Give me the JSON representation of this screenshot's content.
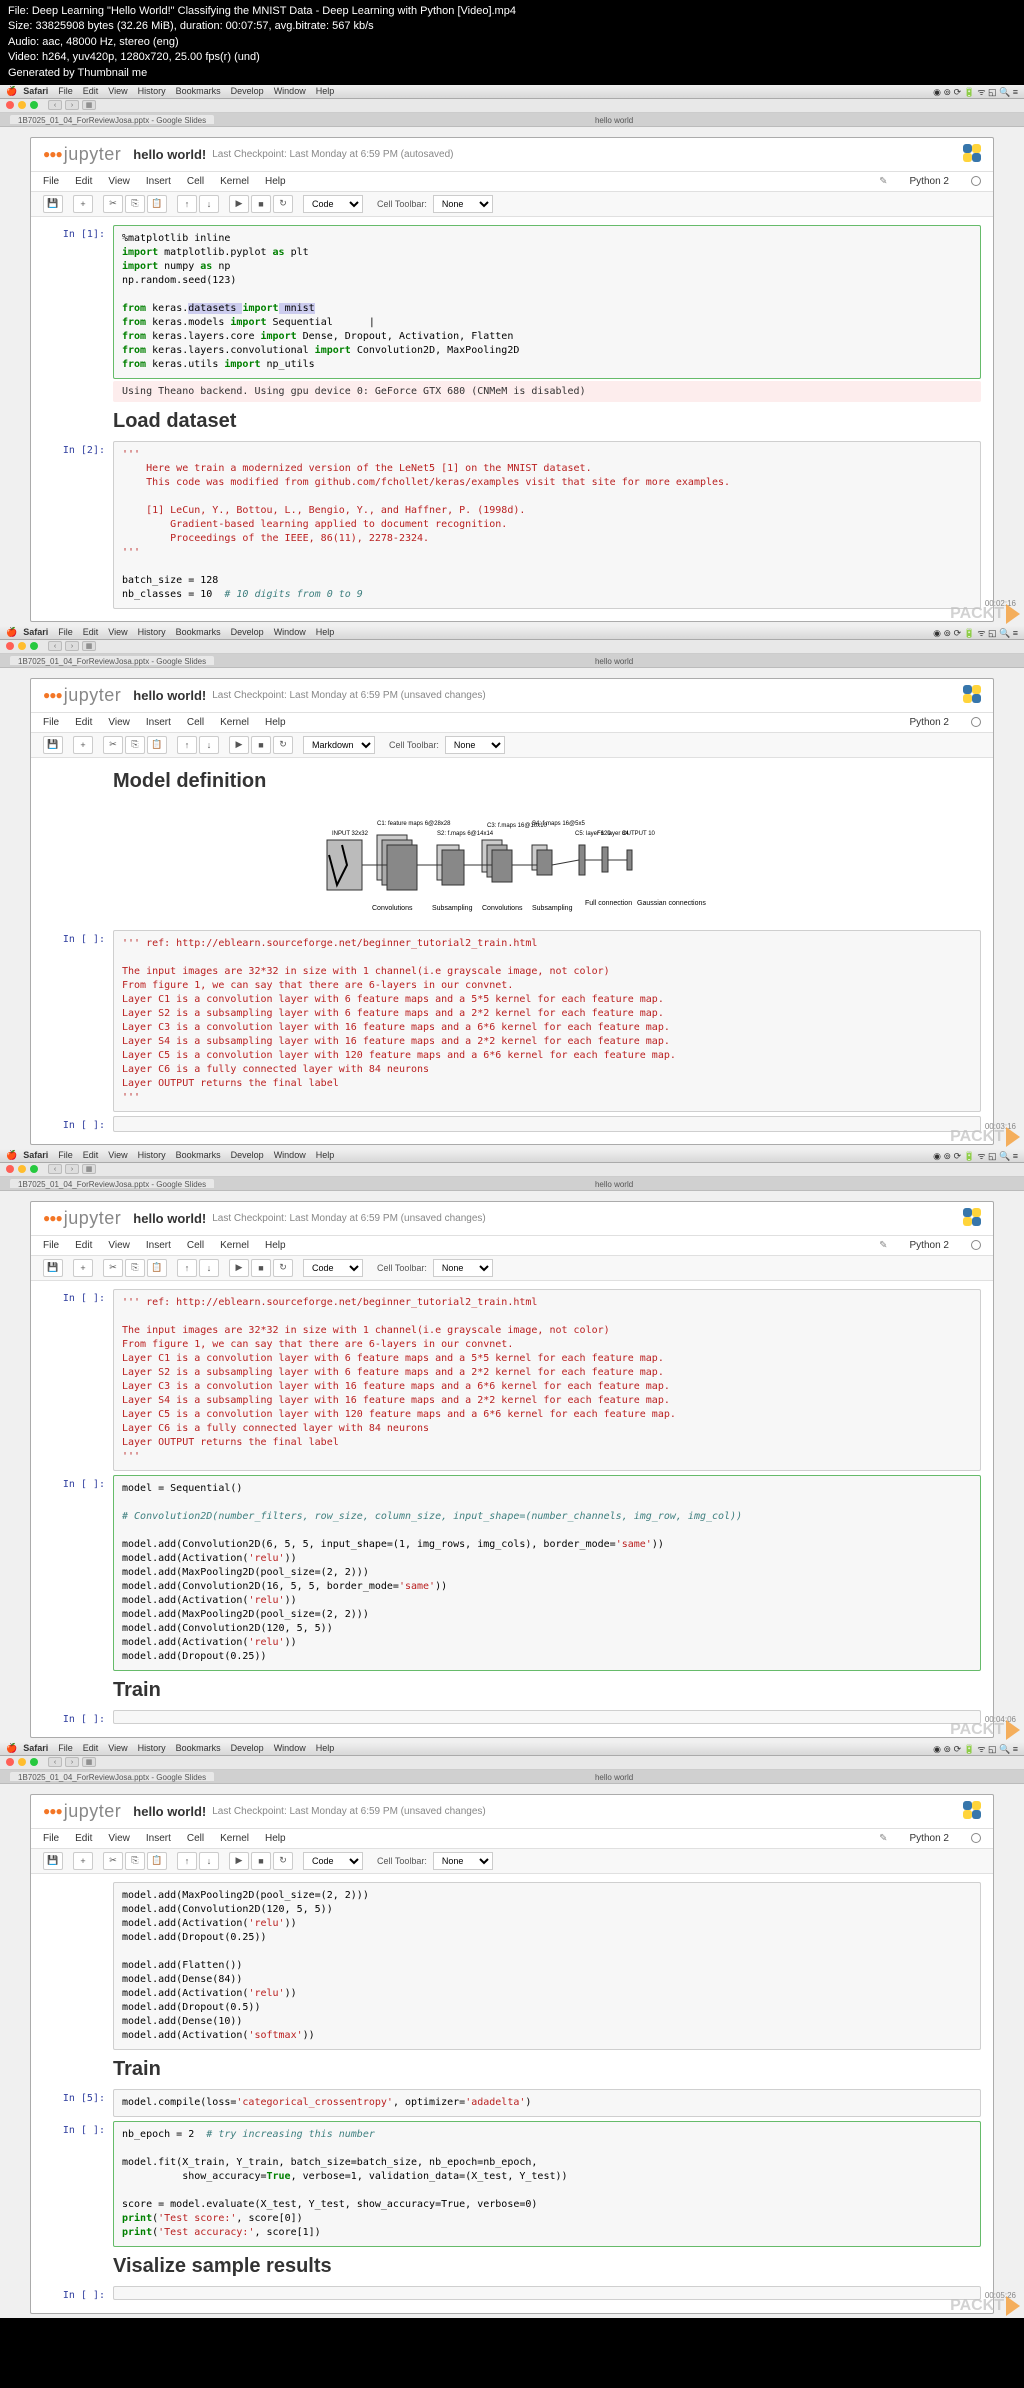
{
  "video_info": {
    "file": "File: Deep Learning \"Hello World!\" Classifying the MNIST Data - Deep Learning with Python [Video].mp4",
    "size": "Size: 33825908 bytes (32.26 MiB), duration: 00:07:57, avg.bitrate: 567 kb/s",
    "audio": "Audio: aac, 48000 Hz, stereo (eng)",
    "video": "Video: h264, yuv420p, 1280x720, 25.00 fps(r) (und)",
    "generated": "Generated by Thumbnail me"
  },
  "mac_menu": {
    "app": "Safari",
    "items": [
      "File",
      "Edit",
      "View",
      "History",
      "Bookmarks",
      "Develop",
      "Window",
      "Help"
    ]
  },
  "browser": {
    "tab_left": "1B7025_01_04_ForReviewJosa.pptx - Google Slides",
    "tab_center": "hello world"
  },
  "jupyter": {
    "logo": "jupyter",
    "title": "hello world!",
    "checkpoint_autosaved": "Last Checkpoint: Last Monday at 6:59 PM (autosaved)",
    "checkpoint_unsaved": "Last Checkpoint: Last Monday at 6:59 PM (unsaved changes)",
    "menu": [
      "File",
      "Edit",
      "View",
      "Insert",
      "Cell",
      "Kernel",
      "Help"
    ],
    "kernel": "Python 2",
    "celltype_code": "Code",
    "celltype_md": "Markdown",
    "celltoolbar_label": "Cell Toolbar:",
    "celltoolbar_val": "None"
  },
  "panel1": {
    "in1_prompt": "In [1]:",
    "in1_code_l1": "%matplotlib inline",
    "in1_code_l2a": "import",
    "in1_code_l2b": " matplotlib.pyplot ",
    "in1_code_l2c": "as",
    "in1_code_l2d": " plt",
    "in1_code_l3a": "import",
    "in1_code_l3b": " numpy ",
    "in1_code_l3c": "as",
    "in1_code_l3d": " np",
    "in1_code_l4": "np.random.seed(123)",
    "in1_code_l5a": "from",
    "in1_code_l5b": " keras.",
    "in1_code_l5c": "datasets ",
    "in1_code_l5d": "import",
    "in1_code_l5e": " mnist",
    "in1_code_l6a": "from",
    "in1_code_l6b": " keras.models ",
    "in1_code_l6c": "import",
    "in1_code_l6d": " Sequential",
    "in1_code_l7a": "from",
    "in1_code_l7b": " keras.layers.core ",
    "in1_code_l7c": "import",
    "in1_code_l7d": " Dense, Dropout, Activation, Flatten",
    "in1_code_l8a": "from",
    "in1_code_l8b": " keras.layers.convolutional ",
    "in1_code_l8c": "import",
    "in1_code_l8d": " Convolution2D, MaxPooling2D",
    "in1_code_l9a": "from",
    "in1_code_l9b": " keras.utils ",
    "in1_code_l9c": "import",
    "in1_code_l9d": " np_utils",
    "out1_l1": "Using Theano backend.",
    "out1_l2": "Using gpu device 0: GeForce GTX 680 (CNMeM is disabled)",
    "heading1": "Load dataset",
    "in2_prompt": "In [2]:",
    "in2_l1": "'''",
    "in2_l2": "    Here we train a modernized version of the LeNet5 [1] on the MNIST dataset.",
    "in2_l3": "    This code was modified from github.com/fchollet/keras/examples visit that site for more examples.",
    "in2_l4": "    [1] LeCun, Y., Bottou, L., Bengio, Y., and Haffner, P. (1998d).",
    "in2_l5": "        Gradient-based learning applied to document recognition.",
    "in2_l6": "        Proceedings of the IEEE, 86(11), 2278-2324.",
    "in2_l7": "'''",
    "in2_l8": "batch_size = 128",
    "in2_l9a": "nb_classes = 10  ",
    "in2_l9b": "# 10 digits from 0 to 9",
    "timestamp": "00:02:16"
  },
  "panel2": {
    "heading": "Model definition",
    "diagram_labels": {
      "input": "INPUT 32x32",
      "c1": "C1: feature maps 6@28x28",
      "s2": "S2: f.maps 6@14x14",
      "c3": "C3: f.maps 16@10x10",
      "s4": "S4: f.maps 16@5x5",
      "c5": "C5: layer 120",
      "f6": "F6: layer 84",
      "output": "OUTPUT 10",
      "conv": "Convolutions",
      "sub": "Subsampling",
      "full": "Full connection",
      "gauss": "Gaussian connections"
    },
    "in_prompt": "In [ ]:",
    "ref_l1": "''' ref: http://eblearn.sourceforge.net/beginner_tutorial2_train.html",
    "ref_l2": "The input images are 32*32 in size with 1 channel(i.e grayscale image, not color)",
    "ref_l3": "From figure 1, we can say that there are 6-layers in our convnet.",
    "ref_l4": "Layer C1 is a convolution layer with 6 feature maps and a 5*5 kernel for each feature map.",
    "ref_l5": "Layer S2 is a subsampling layer with 6 feature maps and a 2*2 kernel for each feature map.",
    "ref_l6": "Layer C3 is a convolution layer with 16 feature maps and a 6*6 kernel for each feature map.",
    "ref_l7": "Layer S4 is a subsampling layer with 16 feature maps and a 2*2 kernel for each feature map.",
    "ref_l8": "Layer C5 is a convolution layer with 120 feature maps and a 6*6 kernel for each feature map.",
    "ref_l9": "Layer C6 is a fully connected layer with 84 neurons",
    "ref_l10": "Layer OUTPUT returns the final label",
    "ref_l11": "'''",
    "timestamp": "00:03:16"
  },
  "panel3": {
    "in_prompt": "In [ ]:",
    "ref_same_as_p2": true,
    "model_l1": "model = Sequential()",
    "model_l2": "# Convolution2D(number_filters, row_size, column_size, input_shape=(number_channels, img_row, img_col))",
    "model_l3a": "model.add(Convolution2D(6, 5, 5, input_shape=(1, img_rows, img_cols), border_mode=",
    "model_l3b": "'same'",
    "model_l3c": "))",
    "model_l4a": "model.add(Activation(",
    "model_l4b": "'relu'",
    "model_l4c": "))",
    "model_l5": "model.add(MaxPooling2D(pool_size=(2, 2)))",
    "model_l6a": "model.add(Convolution2D(16, 5, 5, border_mode=",
    "model_l6b": "'same'",
    "model_l6c": "))",
    "model_l7a": "model.add(Activation(",
    "model_l7b": "'relu'",
    "model_l7c": "))",
    "model_l8": "model.add(MaxPooling2D(pool_size=(2, 2)))",
    "model_l9": "model.add(Convolution2D(120, 5, 5))",
    "model_l10a": "model.add(Activation(",
    "model_l10b": "'relu'",
    "model_l10c": "))",
    "model_l11": "model.add(Dropout(0.25))",
    "heading_train": "Train",
    "timestamp": "00:04:06"
  },
  "panel4": {
    "cont_l1": "model.add(MaxPooling2D(pool_size=(2, 2)))",
    "cont_l2": "model.add(Convolution2D(120, 5, 5))",
    "cont_l3a": "model.add(Activation(",
    "cont_l3b": "'relu'",
    "cont_l3c": "))",
    "cont_l4": "model.add(Dropout(0.25))",
    "cont_l5": "model.add(Flatten())",
    "cont_l6": "model.add(Dense(84))",
    "cont_l7a": "model.add(Activation(",
    "cont_l7b": "'relu'",
    "cont_l7c": "))",
    "cont_l8": "model.add(Dropout(0.5))",
    "cont_l9": "model.add(Dense(10))",
    "cont_l10a": "model.add(Activation(",
    "cont_l10b": "'softmax'",
    "cont_l10c": "))",
    "heading_train": "Train",
    "in5_prompt": "In [5]:",
    "in5_l1a": "model.compile(loss=",
    "in5_l1b": "'categorical_crossentropy'",
    "in5_l1c": ", optimizer=",
    "in5_l1d": "'adadelta'",
    "in5_l1e": ")",
    "in_prompt": "In [ ]:",
    "fit_l1a": "nb_epoch = 2  ",
    "fit_l1b": "# try increasing this number",
    "fit_l2": "model.fit(X_train, Y_train, batch_size=batch_size, nb_epoch=nb_epoch,",
    "fit_l3a": "          show_accuracy=",
    "fit_l3b": "True",
    "fit_l3c": ", verbose=1, validation_data=(X_test, Y_test))",
    "fit_l4": "score = model.evaluate(X_test, Y_test, show_accuracy=True, verbose=0)",
    "fit_l5a": "print",
    "fit_l5b": "(",
    "fit_l5c": "'Test score:'",
    "fit_l5d": ", score[0])",
    "fit_l6a": "print",
    "fit_l6b": "(",
    "fit_l6c": "'Test accuracy:'",
    "fit_l6d": ", score[1])",
    "heading_viz": "Visalize sample results",
    "timestamp": "00:05:26"
  },
  "watermark": "PACKT"
}
